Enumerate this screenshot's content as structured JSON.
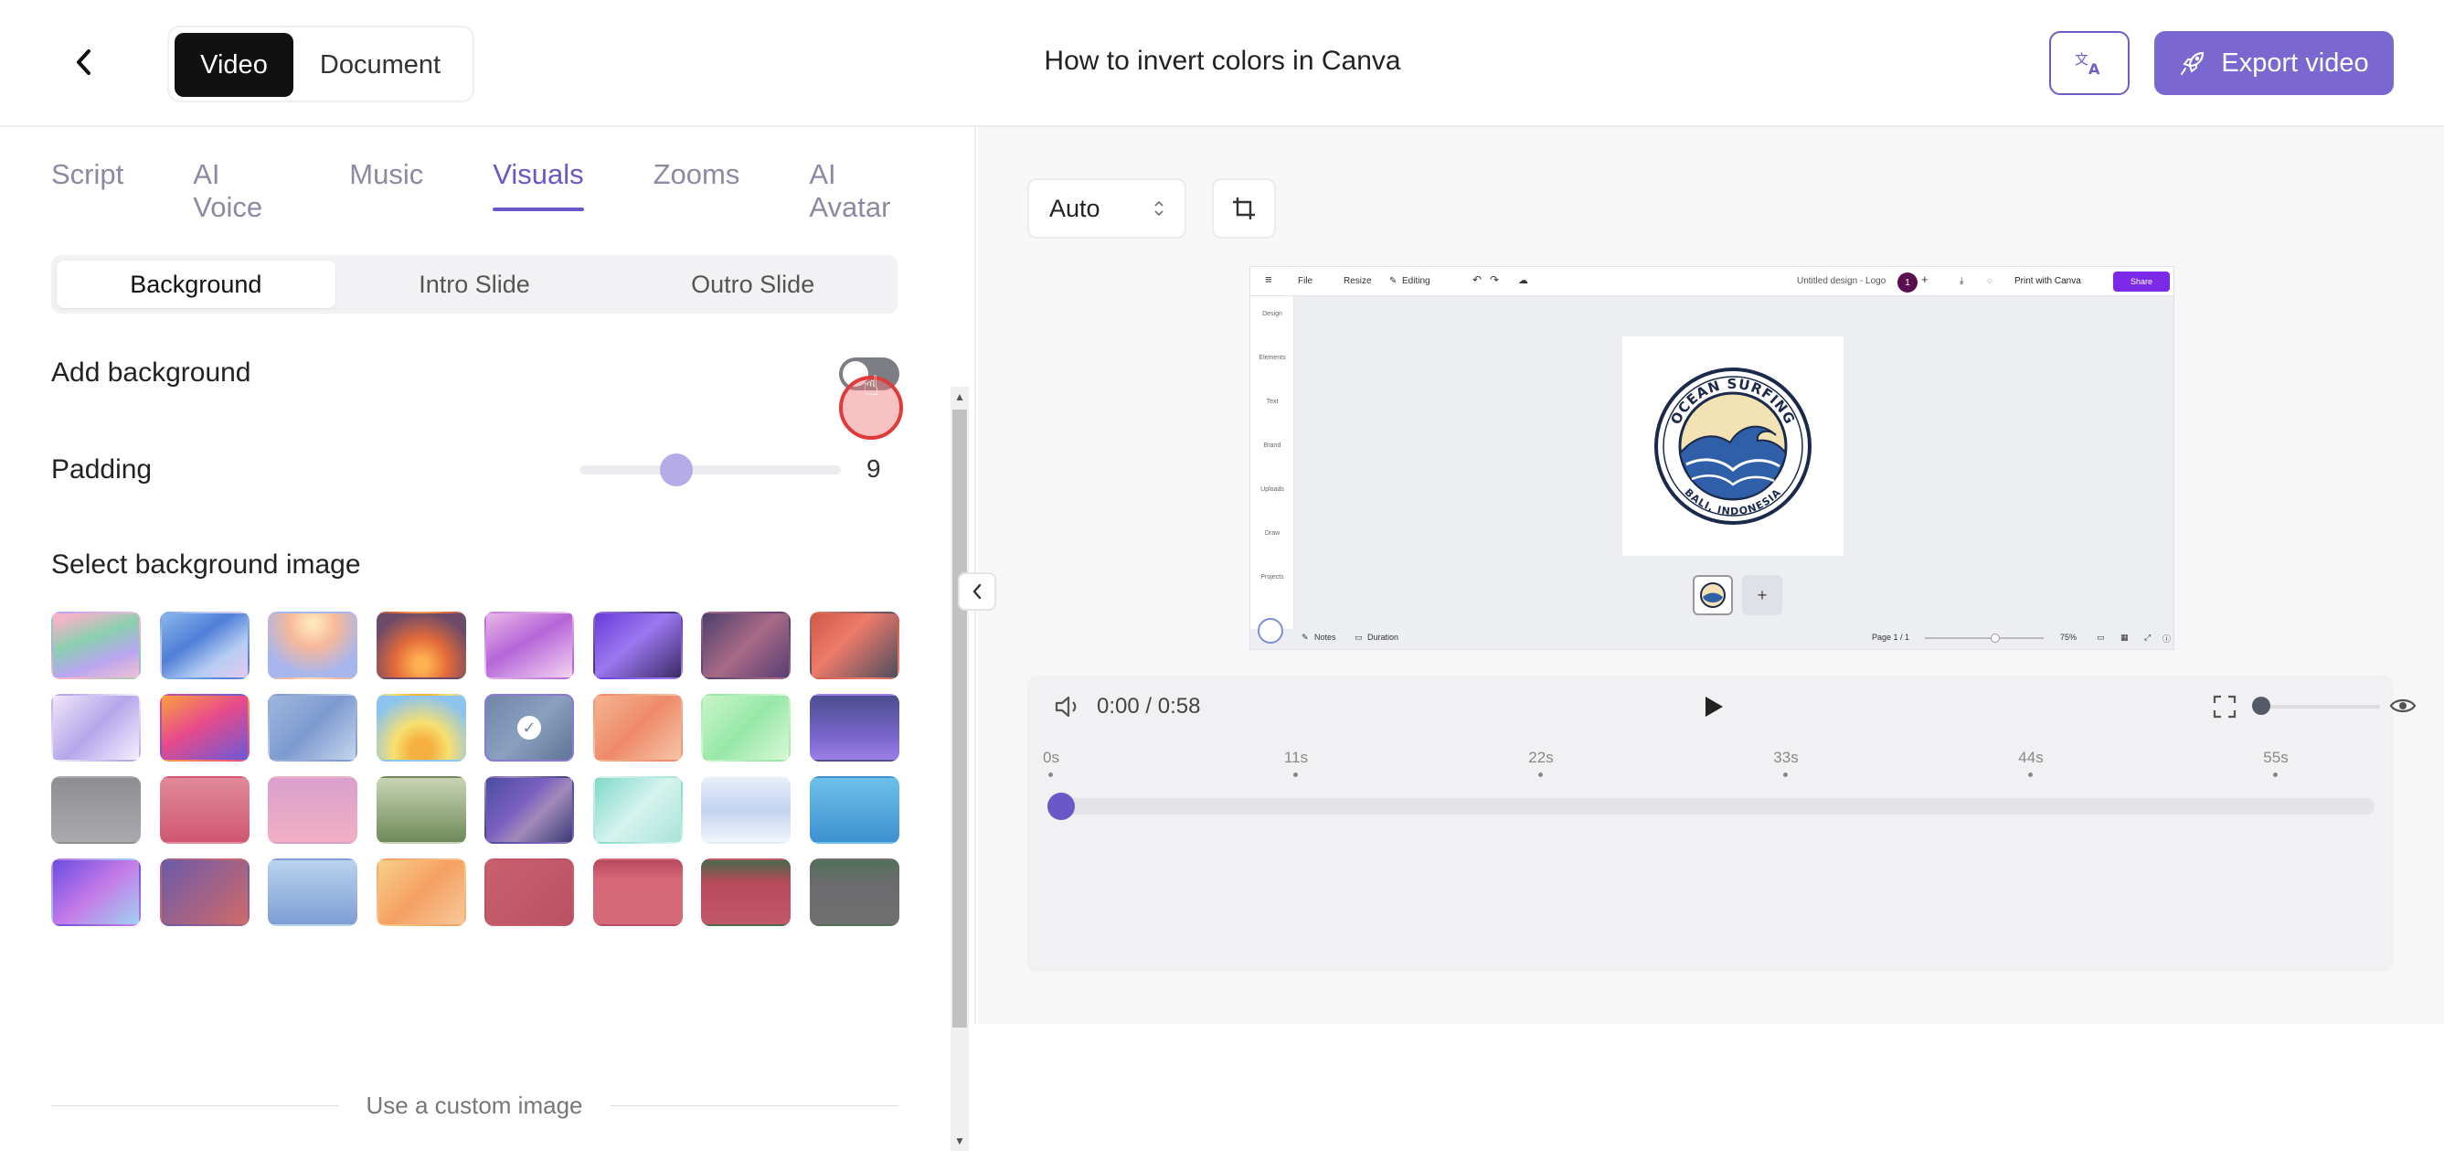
{
  "header": {
    "mode_video": "Video",
    "mode_document": "Document",
    "title": "How to invert colors in Canva",
    "export_label": "Export video",
    "accent": "#7a67cf"
  },
  "left": {
    "tabs": [
      "Script",
      "AI Voice",
      "Music",
      "Visuals",
      "Zooms",
      "AI Avatar"
    ],
    "active_tab": "Visuals",
    "subtabs": [
      "Background",
      "Intro Slide",
      "Outro Slide"
    ],
    "active_subtab": "Background",
    "add_background_label": "Add background",
    "add_background_on": false,
    "padding_label": "Padding",
    "padding_value": "9",
    "padding_fraction": 0.37,
    "select_bg_label": "Select background image",
    "custom_image_label": "Use a custom image",
    "selected_thumb_index": 12,
    "thumbs": [
      "linear-gradient(160deg,#f2b4c8 10%,#8ad0b0 40%,#b9a5f0 70%,#f0c2d2 100%)",
      "linear-gradient(145deg,#8ab6ea 0%,#4f7fd8 40%,#b6cdf2 70%,#e4c8f0 100%)",
      "radial-gradient(circle at 50% 15%,#ffe6b8 5%,#f6b89a 35%,#a8b6ee 75%)",
      "radial-gradient(circle at 50% 80%,#ffb050 10%,#e36a3a 40%,#6b4a6a 80%)",
      "linear-gradient(150deg,#e9b7e6 0%,#b665d8 45%,#f3d3f2 100%)",
      "linear-gradient(140deg,#6a3ad8 0%,#9b78f0 45%,#3b2b66 100%)",
      "linear-gradient(135deg,#4c3f6e 0%,#a86a86 50%,#5a3e74 100%)",
      "linear-gradient(135deg,#d05a4a 0%,#ee7a6a 40%,#4e4e5e 100%)",
      "linear-gradient(135deg,#efe6f8 0%,#b5a6ea 50%,#f5efff 100%)",
      "linear-gradient(150deg,#f8a040 0%,#e84a8a 45%,#6a5ad8 100%)",
      "linear-gradient(135deg,#9fb6dc 0%,#7d9ad0 50%,#c7d6ee 100%)",
      "radial-gradient(circle at 50% 85%,#f6b040 15%,#f7e070 40%,#8cc4ee 80%)",
      "linear-gradient(135deg,#6f86a8 0%,#8aa0bf 50%,#5e7595 100%)",
      "linear-gradient(135deg,#f5b490 0%,#ee8a6a 50%,#f6c5a8 100%)",
      "linear-gradient(135deg,#c9f5c9 0%,#97e8a8 50%,#d8f8d6 100%)",
      "linear-gradient(180deg,#4d4e8f 0%,#7664c8 60%,#9b7ee6 100%)",
      "linear-gradient(180deg,#8e8e92 0%,#a9a9ae 100%)",
      "linear-gradient(180deg,#e08a9a 0%,#d0576f 100%)",
      "linear-gradient(180deg,#d9a0cc 0%,#f2b0c4 100%)",
      "linear-gradient(180deg,#c9d4b4 0%,#6e8a5a 100%)",
      "linear-gradient(135deg,#4a4ea0 0%,#7a5fc0 40%,#a08ab8 60%,#3a3a78 100%)",
      "linear-gradient(135deg,#7fd8c8 0%,#d6f3ee 50%,#a9e4d8 100%)",
      "linear-gradient(180deg,#e8eefb 0%,#c2d4f0 50%,#f2f5fc 100%)",
      "linear-gradient(180deg,#6dc0e8 0%,#3e90d0 100%)",
      "linear-gradient(140deg,#6a4de0 0%,#c57ae8 50%,#9fd2f0 100%)",
      "linear-gradient(135deg,#6b5aa8 0%,#d06a6a 100%)",
      "linear-gradient(180deg,#b9d2ee 0%,#7e9ed4 100%)",
      "linear-gradient(135deg,#f8d08a 0%,#f5a062 50%,#f8c89a 100%)",
      "linear-gradient(135deg,#c8606e 0%,#b85262 100%)",
      "linear-gradient(180deg,#b84a5e 0%,#d66878 30%,#d36a78 100%)",
      "linear-gradient(180deg,#496a4a 0%,#b84a5a 35%,#c05868 100%)",
      "linear-gradient(180deg,#52705a 0%,#6b6b6e 35%,#707070 100%)"
    ]
  },
  "right": {
    "aspect_select": "Auto",
    "preview": {
      "file": "File",
      "resize": "Resize",
      "editing": "Editing",
      "doc_title": "Untitled design - Logo",
      "avatar": "1",
      "print": "Print with Canva",
      "share": "Share",
      "side_items": [
        "Design",
        "Elements",
        "Text",
        "Brand",
        "Uploads",
        "Draw",
        "Projects"
      ],
      "logo_top": "OCEAN SURFING",
      "logo_bottom": "BALI, INDONESIA",
      "notes": "Notes",
      "duration": "Duration",
      "page": "Page 1 / 1",
      "zoom": "75%"
    },
    "player": {
      "time": "0:00 / 0:58",
      "progress_fraction": 0.0,
      "ticks": [
        "0s",
        "11s",
        "22s",
        "33s",
        "44s",
        "55s"
      ]
    }
  }
}
